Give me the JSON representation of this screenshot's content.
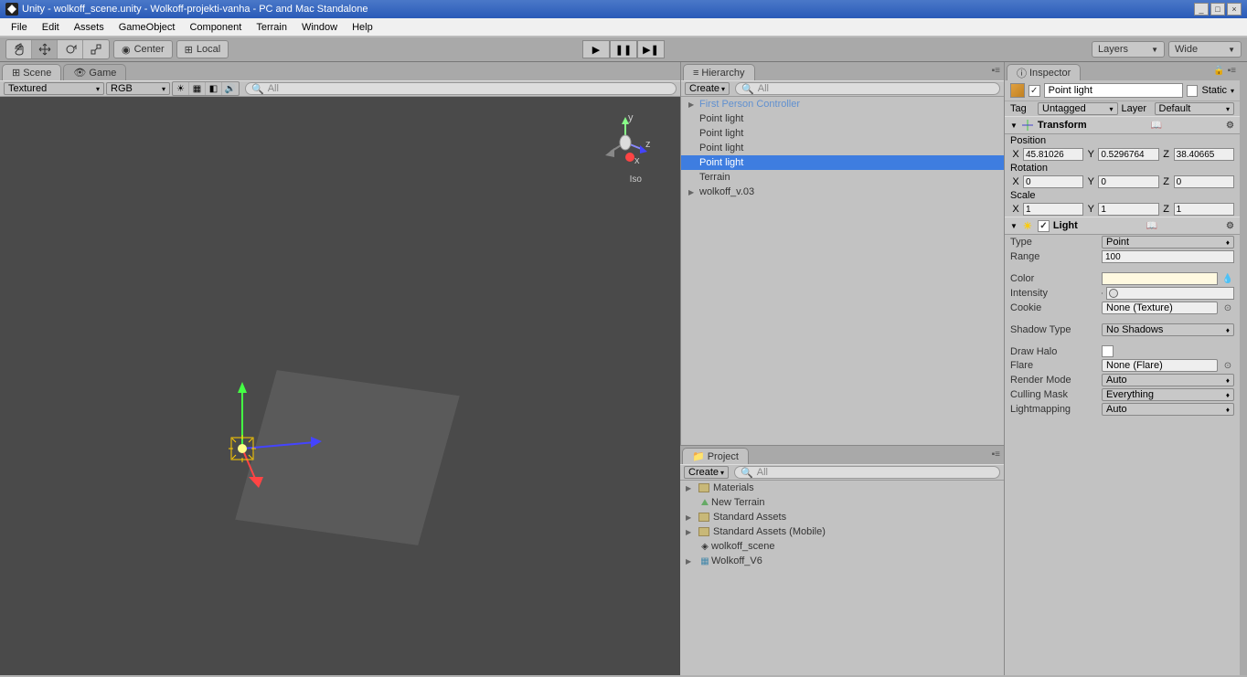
{
  "title": "Unity - wolkoff_scene.unity - Wolkoff-projekti-vanha - PC and Mac Standalone",
  "menu": [
    "File",
    "Edit",
    "Assets",
    "GameObject",
    "Component",
    "Terrain",
    "Window",
    "Help"
  ],
  "toolbar": {
    "center": "Center",
    "local": "Local",
    "layers": "Layers",
    "layout": "Wide"
  },
  "scene": {
    "tab_scene": "Scene",
    "tab_game": "Game",
    "shading": "Textured",
    "rendermode": "RGB",
    "search_placeholder": "All",
    "iso": "Iso",
    "axes": {
      "x": "x",
      "y": "y",
      "z": "z"
    }
  },
  "hierarchy": {
    "tab": "Hierarchy",
    "create": "Create",
    "search_placeholder": "All",
    "items": [
      {
        "name": "First Person Controller",
        "prefab": true,
        "expandable": true
      },
      {
        "name": "Point light"
      },
      {
        "name": "Point light"
      },
      {
        "name": "Point light"
      },
      {
        "name": "Point light",
        "selected": true
      },
      {
        "name": "Terrain"
      },
      {
        "name": "wolkoff_v.03",
        "expandable": true
      }
    ]
  },
  "project": {
    "tab": "Project",
    "create": "Create",
    "search_placeholder": "All",
    "items": [
      {
        "name": "Materials",
        "type": "folder",
        "expandable": true
      },
      {
        "name": "New Terrain",
        "type": "terrain"
      },
      {
        "name": "Standard Assets",
        "type": "folder",
        "expandable": true
      },
      {
        "name": "Standard Assets (Mobile)",
        "type": "folder",
        "expandable": true
      },
      {
        "name": "wolkoff_scene",
        "type": "scene"
      },
      {
        "name": "Wolkoff_V6",
        "type": "prefab",
        "expandable": true
      }
    ]
  },
  "inspector": {
    "tab": "Inspector",
    "object_name": "Point light",
    "static_label": "Static",
    "tag_label": "Tag",
    "tag_value": "Untagged",
    "layer_label": "Layer",
    "layer_value": "Default",
    "transform": {
      "title": "Transform",
      "pos_label": "Position",
      "rot_label": "Rotation",
      "scale_label": "Scale",
      "pos": {
        "x": "45.81026",
        "y": "0.5296764",
        "z": "38.40665"
      },
      "rot": {
        "x": "0",
        "y": "0",
        "z": "0"
      },
      "scale": {
        "x": "1",
        "y": "1",
        "z": "1"
      }
    },
    "light": {
      "title": "Light",
      "type_label": "Type",
      "type_value": "Point",
      "range_label": "Range",
      "range_value": "100",
      "color_label": "Color",
      "color_value": "#fffce8",
      "intensity_label": "Intensity",
      "intensity_value": "1",
      "cookie_label": "Cookie",
      "cookie_value": "None (Texture)",
      "shadow_label": "Shadow Type",
      "shadow_value": "No Shadows",
      "halo_label": "Draw Halo",
      "flare_label": "Flare",
      "flare_value": "None (Flare)",
      "render_label": "Render Mode",
      "render_value": "Auto",
      "culling_label": "Culling Mask",
      "culling_value": "Everything",
      "lightmap_label": "Lightmapping",
      "lightmap_value": "Auto"
    }
  }
}
